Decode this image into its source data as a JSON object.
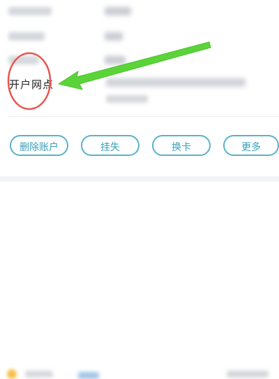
{
  "account_info": {
    "outlet_label": "开户网点"
  },
  "actions": {
    "delete_account": "删除账户",
    "report_loss": "挂失",
    "change_card": "换卡",
    "more": "更多"
  },
  "colors": {
    "button_border": "#58b3c9",
    "button_text": "#3aa0ba",
    "annotation_circle": "#e8564f",
    "annotation_arrow": "#5bd43a"
  }
}
